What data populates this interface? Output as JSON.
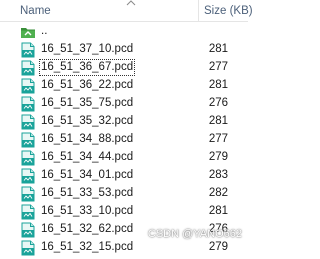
{
  "header": {
    "name_label": "Name",
    "size_label": "Size (KB)",
    "sort_indicator": "up-caret"
  },
  "rows": [
    {
      "name": "..",
      "size": "",
      "icon": "folder-up-icon"
    },
    {
      "name": "16_51_37_10.pcd",
      "size": "281",
      "icon": "pcd-file-icon"
    },
    {
      "name": "16_51_36_67.pcd",
      "size": "277",
      "icon": "pcd-file-icon",
      "selected": true
    },
    {
      "name": "16_51_36_22.pcd",
      "size": "281",
      "icon": "pcd-file-icon"
    },
    {
      "name": "16_51_35_75.pcd",
      "size": "276",
      "icon": "pcd-file-icon"
    },
    {
      "name": "16_51_35_32.pcd",
      "size": "281",
      "icon": "pcd-file-icon"
    },
    {
      "name": "16_51_34_88.pcd",
      "size": "277",
      "icon": "pcd-file-icon"
    },
    {
      "name": "16_51_34_44.pcd",
      "size": "279",
      "icon": "pcd-file-icon"
    },
    {
      "name": "16_51_34_01.pcd",
      "size": "283",
      "icon": "pcd-file-icon"
    },
    {
      "name": "16_51_33_53.pcd",
      "size": "282",
      "icon": "pcd-file-icon"
    },
    {
      "name": "16_51_33_10.pcd",
      "size": "281",
      "icon": "pcd-file-icon"
    },
    {
      "name": "16_51_32_62.pcd",
      "size": "276",
      "icon": "pcd-file-icon"
    },
    {
      "name": "16_51_32_15.pcd",
      "size": "279",
      "icon": "pcd-file-icon"
    }
  ],
  "watermark": "CSDN @YANO662",
  "colors": {
    "header_text": "#4c607a",
    "file_icon_teal": "#1aa39a",
    "folder_icon_green": "#3a8f3a"
  }
}
